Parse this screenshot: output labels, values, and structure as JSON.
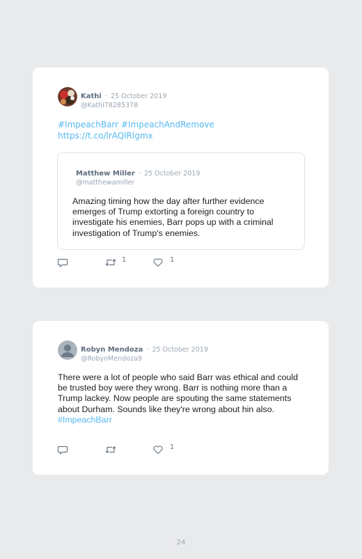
{
  "tweets": [
    {
      "author": "Kathi",
      "sep": "·",
      "date": "25 October 2019",
      "handle": "@Kathi78285378",
      "hashtags": [
        "#ImpeachBarr",
        "#ImpeachAndRemove"
      ],
      "link": "https://t.co/lrAQlRlgmx",
      "quoted": {
        "author": "Matthew Miller",
        "sep": "·",
        "date": "25 October 2019",
        "handle": "@matthewamiller",
        "text": "Amazing timing how the day after further evidence emerges of Trump extorting a foreign country to investigate his enemies, Barr pops up with a criminal investigation of Trump's enemies."
      },
      "retweets": "1",
      "likes": "1"
    },
    {
      "author": "Robyn Mendoza",
      "sep": "·",
      "date": "25 October 2019",
      "handle": "@RobynMendoza9",
      "text": "There were a lot of people who said Barr was ethical and could be trusted boy were they wrong. Barr is nothing more than a Trump lackey. Now people are spouting the same statements about Durham. Sounds like they're wrong about hin also.",
      "hashtag": "#ImpeachBarr",
      "likes": "1"
    }
  ],
  "icons": {
    "reply": "reply-icon",
    "retweet": "retweet-icon",
    "like": "heart-icon"
  },
  "colors": {
    "page_bg": "#e9eaec",
    "card_bg": "#ffffff",
    "link": "#55b8f0",
    "name": "#5e6e7d",
    "muted": "#9aa6b2"
  },
  "page_number": "24"
}
